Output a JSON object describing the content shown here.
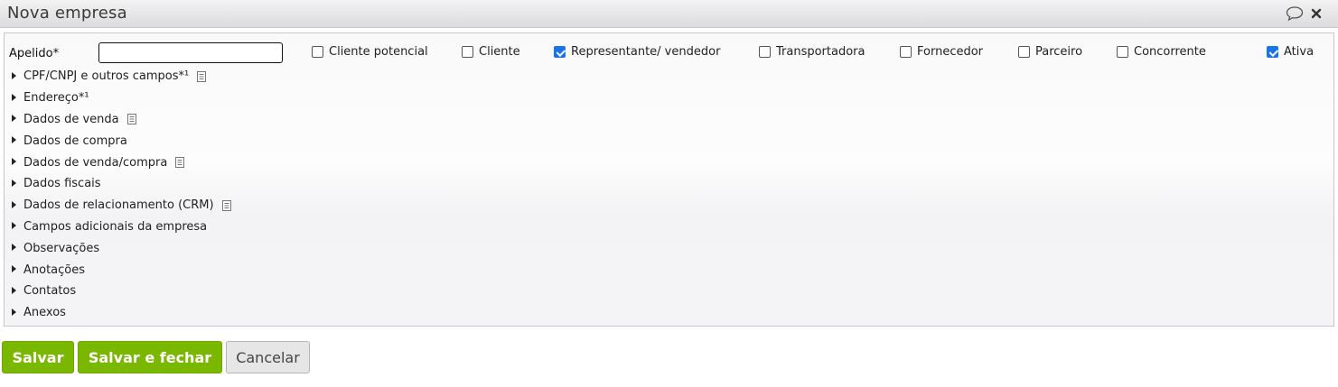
{
  "window": {
    "title": "Nova empresa",
    "icons": [
      "speech-bubble-icon",
      "close-icon"
    ]
  },
  "form": {
    "apelido_label": "Apelido*",
    "apelido_value": "",
    "checkboxes": [
      {
        "label": "Cliente potencial",
        "checked": false
      },
      {
        "label": "Cliente",
        "checked": false
      },
      {
        "label": "Representante/ vendedor",
        "checked": true
      },
      {
        "label": "Transportadora",
        "checked": false
      },
      {
        "label": "Fornecedor",
        "checked": false
      },
      {
        "label": "Parceiro",
        "checked": false
      },
      {
        "label": "Concorrente",
        "checked": false
      },
      {
        "label": "Ativa",
        "checked": true
      }
    ]
  },
  "sections": [
    {
      "label": "CPF/CNPJ e outros campos*¹",
      "doc_icon": true
    },
    {
      "label": "Endereço*¹",
      "doc_icon": false
    },
    {
      "label": "Dados de venda",
      "doc_icon": true
    },
    {
      "label": "Dados de compra",
      "doc_icon": false
    },
    {
      "label": "Dados de venda/compra",
      "doc_icon": true
    },
    {
      "label": "Dados fiscais",
      "doc_icon": false
    },
    {
      "label": "Dados de relacionamento (CRM)",
      "doc_icon": true
    },
    {
      "label": "Campos adicionais da empresa",
      "doc_icon": false
    },
    {
      "label": "Observações",
      "doc_icon": false
    },
    {
      "label": "Anotações",
      "doc_icon": false
    },
    {
      "label": "Contatos",
      "doc_icon": false
    },
    {
      "label": "Anexos",
      "doc_icon": false
    }
  ],
  "buttons": {
    "save": "Salvar",
    "save_close": "Salvar e fechar",
    "cancel": "Cancelar"
  },
  "colors": {
    "accent_green": "#7ab800",
    "checkbox_blue": "#1a73e8"
  }
}
